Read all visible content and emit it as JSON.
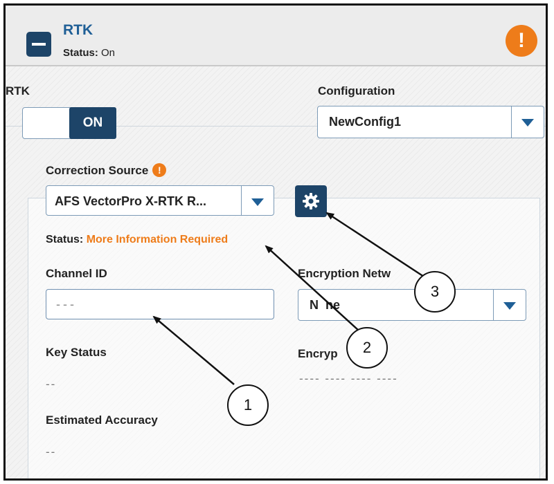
{
  "header": {
    "title": "RTK",
    "status_label": "Status:",
    "status_value": "On",
    "warning_glyph": "!"
  },
  "rtk": {
    "label": "RTK",
    "toggle_value": "ON"
  },
  "configuration": {
    "label": "Configuration",
    "selected": "NewConfig1"
  },
  "correction_source": {
    "label": "Correction Source",
    "warning_glyph": "!",
    "selected": "AFS VectorPro X-RTK R..."
  },
  "status": {
    "label": "Status:",
    "value": "More Information Required",
    "value_color": "#ee7c1a"
  },
  "channel_id": {
    "label": "Channel ID",
    "placeholder": "---"
  },
  "encryption_network": {
    "label": "Encryption Netw",
    "selected": "N  ne"
  },
  "key_status": {
    "label": "Key Status",
    "value": "--"
  },
  "encryption_key": {
    "label": "Encryp",
    "value": "---- ---- ---- ----"
  },
  "estimated_accuracy": {
    "label": "Estimated Accuracy",
    "value": "--"
  },
  "callouts": [
    "1",
    "2",
    "3"
  ],
  "colors": {
    "accent_dark": "#1d4468",
    "title_blue": "#1f5f96",
    "warning_orange": "#ee7c1a"
  }
}
